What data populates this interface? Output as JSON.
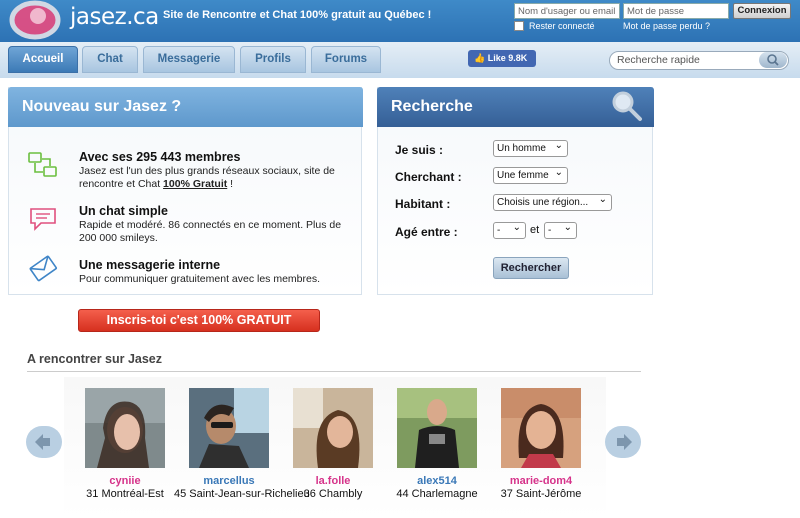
{
  "header": {
    "logo_text": "jasez.ca",
    "tagline": "Site de Rencontre et Chat 100% gratuit au Québec !",
    "login": {
      "username_placeholder": "Nom d'usager ou email",
      "password_placeholder": "Mot de passe",
      "submit_label": "Connexion",
      "remember_label": "Rester connecté",
      "forgot_label": "Mot de passe perdu ?"
    }
  },
  "nav": {
    "tabs": [
      {
        "label": "Accueil",
        "active": true
      },
      {
        "label": "Chat"
      },
      {
        "label": "Messagerie"
      },
      {
        "label": "Profils"
      },
      {
        "label": "Forums"
      }
    ],
    "like_label": "Like 9.8K",
    "search_placeholder": "Recherche rapide"
  },
  "nouveau": {
    "title": "Nouveau sur Jasez ?",
    "features": [
      {
        "icon": "chat-network-icon",
        "title": "Avec ses 295 443 membres",
        "text_before": "Jasez est l'un des plus grands réseaux sociaux, site de rencontre et Chat ",
        "text_link": "100% Gratuit",
        "text_after": " !"
      },
      {
        "icon": "speech-bubble-icon",
        "title": "Un chat simple",
        "text": "Rapide et modéré. 86 connectés en ce moment. Plus de 200 000 smileys."
      },
      {
        "icon": "envelope-icon",
        "title": "Une messagerie interne",
        "text": "Pour communiquer gratuitement avec les membres."
      }
    ],
    "cta_label": "Inscris-toi c'est 100% GRATUIT"
  },
  "recherche": {
    "title": "Recherche",
    "je_suis_label": "Je suis :",
    "je_suis_value": "Un homme",
    "cherchant_label": "Cherchant :",
    "cherchant_value": "Une femme",
    "habitant_label": "Habitant :",
    "habitant_value": "Choisis une région...",
    "age_label": "Agé entre :",
    "age_min": "-",
    "age_and": "et",
    "age_max": "-",
    "submit_label": "Rechercher"
  },
  "rencontrer": {
    "title": "A rencontrer sur Jasez",
    "profiles": [
      {
        "name": "cyniie",
        "info": "31 Montréal-Est",
        "name_color": "#d6338a"
      },
      {
        "name": "marcellus",
        "info": "45 Saint-Jean-sur-Richelieu",
        "name_color": "#3a78b7"
      },
      {
        "name": "la.folle",
        "info": "36 Chambly",
        "name_color": "#d6338a"
      },
      {
        "name": "alex514",
        "info": "44 Charlemagne",
        "name_color": "#3a78b7"
      },
      {
        "name": "marie-dom4",
        "info": "37 Saint-Jérôme",
        "name_color": "#d6338a"
      }
    ]
  },
  "colors": {
    "header_blue": "#2d72b4",
    "cta_red": "#d6301f",
    "female_pink": "#d6338a",
    "male_blue": "#3a78b7"
  }
}
